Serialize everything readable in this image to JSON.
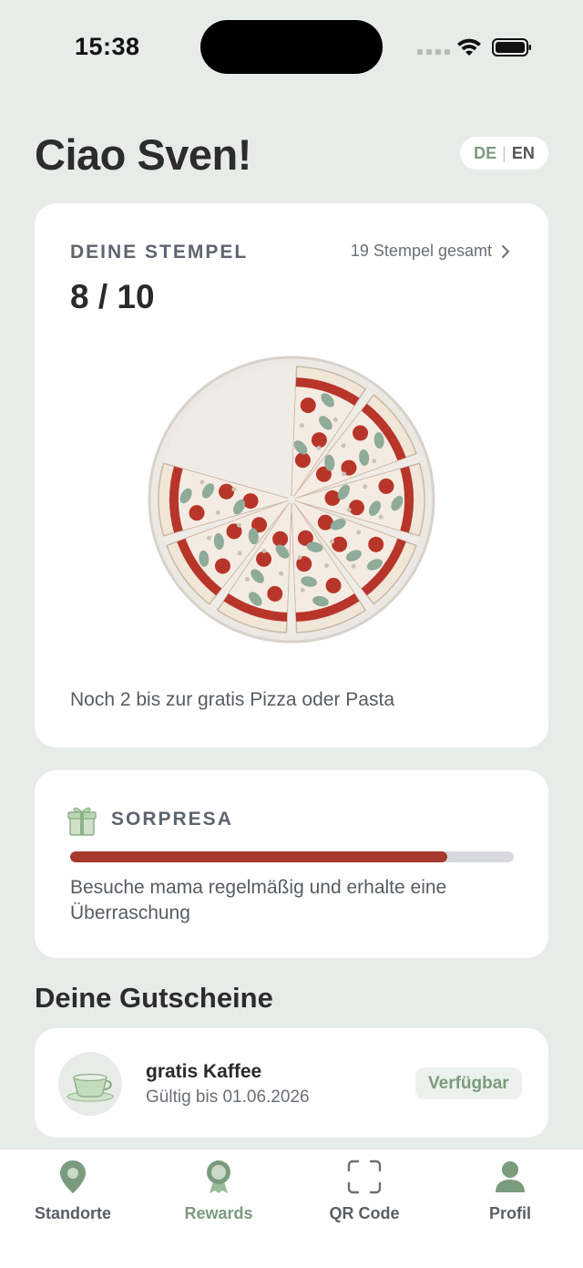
{
  "status_bar": {
    "time": "15:38"
  },
  "header": {
    "greeting": "Ciao Sven!",
    "lang_de": "DE",
    "lang_sep": "|",
    "lang_en": "EN"
  },
  "stamps": {
    "label": "DEINE STEMPEL",
    "total_link": "19 Stempel gesamt",
    "count": "8 / 10",
    "collected": 8,
    "goal": 10,
    "hint": "Noch 2 bis zur gratis Pizza oder Pasta"
  },
  "surprise": {
    "label": "SORPRESA",
    "progress": 0.85,
    "text": "Besuche mama regelmäßig und erhalte eine Überraschung"
  },
  "vouchers": {
    "section_title": "Deine Gutscheine",
    "items": [
      {
        "title": "gratis Kaffee",
        "valid": "Gültig bis 01.06.2026",
        "badge": "Verfügbar",
        "icon": "coffee-cup-icon"
      }
    ]
  },
  "tab_bar": {
    "items": [
      {
        "label": "Standorte",
        "icon": "map-pin-icon",
        "active": false
      },
      {
        "label": "Rewards",
        "icon": "medal-icon",
        "active": true
      },
      {
        "label": "QR Code",
        "icon": "qr-scan-icon",
        "active": false
      },
      {
        "label": "Profil",
        "icon": "profile-icon",
        "active": false
      }
    ]
  },
  "colors": {
    "accent_green": "#7b9b7e",
    "progress_red": "#a63a2e",
    "background": "#e8ece8"
  }
}
